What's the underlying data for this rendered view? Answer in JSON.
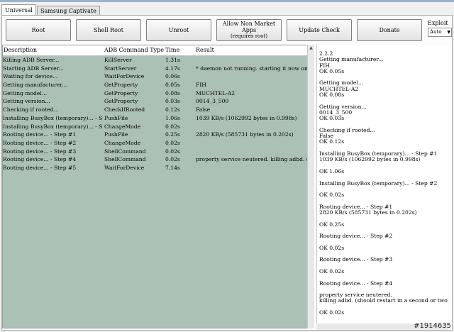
{
  "tabs": [
    {
      "label": "Universal",
      "active": true
    },
    {
      "label": "Samsung Captivate",
      "active": false
    }
  ],
  "toolbar": {
    "buttons": [
      "Root",
      "Shell Root",
      "Unroot"
    ],
    "non_market": {
      "label": "Allow Non Market Apps",
      "sub": "(requires root)"
    },
    "buttons2": [
      "Update Check",
      "Donate"
    ]
  },
  "exploit": {
    "label": "Exploit",
    "value": "Auto"
  },
  "grid": {
    "headers": [
      "Description",
      "ADB Command Type",
      "Time",
      "Result"
    ],
    "rows": [
      [
        "Killing ADB Server...",
        "KillServer",
        "1.31s",
        ""
      ],
      [
        "Starting ADB Server...",
        "StartServer",
        "4.17s",
        "* daemon not running. starting it now on port ..."
      ],
      [
        "Waiting for device...",
        "WaitForDevice",
        "0.06s",
        ""
      ],
      [
        "Getting manufacturer...",
        "GetProperty",
        "0.05s",
        "FIH"
      ],
      [
        "Getting model...",
        "GetProperty",
        "0.08s",
        "MUCHTEL-A2"
      ],
      [
        "Getting version...",
        "GetProperty",
        "0.03s",
        "0014_3_500"
      ],
      [
        "Checking if rooted...",
        "CheckIfRooted",
        "0.12s",
        "False"
      ],
      [
        "Installing BusyBox (temporary)... - St...",
        "PushFile",
        "1.06s",
        "1039 KB/s (1062992 bytes in 0.998s)"
      ],
      [
        "Installing BusyBox (temporary)... - St...",
        "ChangeMode",
        "0.02s",
        ""
      ],
      [
        "Rooting device... - Step #1",
        "PushFile",
        "0.25s",
        "2820 KB/s (585731 bytes in 0.202s)"
      ],
      [
        "Rooting device... - Step #2",
        "ChangeMode",
        "0.02s",
        ""
      ],
      [
        "Rooting device... - Step #3",
        "ShellCommand",
        "0.02s",
        ""
      ],
      [
        "Rooting device... - Step #4",
        "ShellCommand",
        "0.02s",
        "  property service neutered.   killing adbd. (sh..."
      ],
      [
        "Rooting device... - Step #5",
        "WaitForDevice",
        "7.14s",
        ""
      ]
    ]
  },
  "log": {
    "lines": [
      "2.2.2",
      "Getting manufacturer...",
      "FIH",
      "OK 0.05s",
      "",
      "Getting model...",
      "MUCHTEL-A2",
      "OK 0.08s",
      "",
      "Getting version...",
      "0014_3_500",
      "OK 0.03s",
      "",
      "Checking if rooted...",
      "False",
      "OK 0.12s",
      "",
      "Installing BusyBox (temporary)... - Step #1",
      "1039 KB/s (1062992 bytes in 0.998s)",
      "",
      "OK 1.06s",
      "",
      "Installing BusyBox (temporary)... - Step #2",
      "",
      "OK 0.02s",
      "",
      "Rooting device... - Step #1",
      "2820 KB/s (585731 bytes in 0.202s)",
      "",
      "OK 0.25s",
      "",
      "Rooting device... - Step #2",
      "",
      "OK 0.02s",
      "",
      "Rooting device... - Step #3",
      "",
      "OK 0.02s",
      "",
      "Rooting device... - Step #4",
      "",
      "property service neutered.",
      "killing adbd. (should restart in a second or two)",
      "",
      "OK 0.02s"
    ]
  },
  "watermark": "#1914635"
}
